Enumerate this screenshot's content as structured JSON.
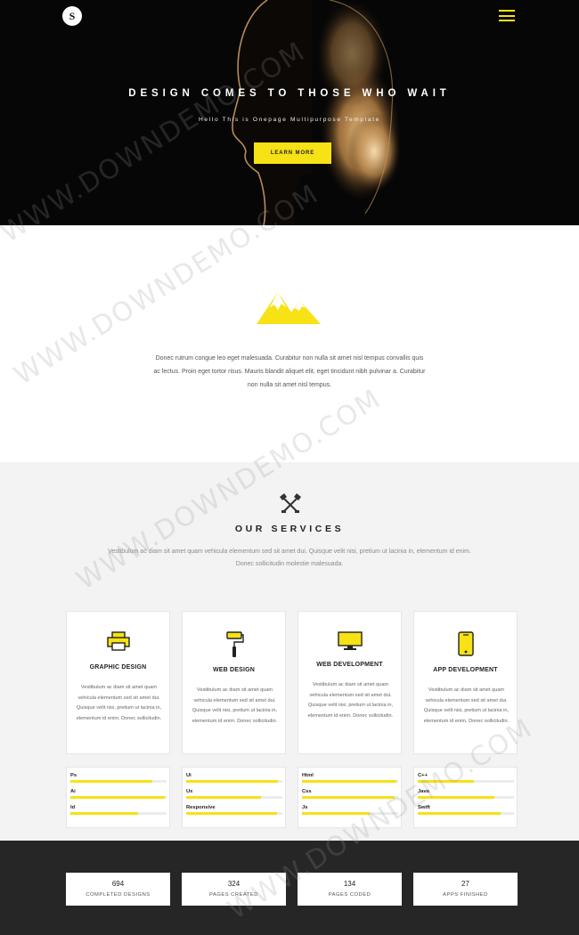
{
  "hero": {
    "logo_text": "S",
    "title": "DESIGN COMES TO THOSE WHO WAIT",
    "subtitle": "Hello This is Onepage Multipurpose Template",
    "button": "LEARN MORE"
  },
  "intro": {
    "text": "Donec rutrum congue leo eget malesuada. Curabitur non nulla sit amet nisl tempus convallis quis ac lectus. Proin eget tortor risus. Mauris blandit aliquet elit, eget tincidunt nibh pulvinar a. Curabitur non nulla sit amet nisl tempus."
  },
  "services": {
    "title": "OUR SERVICES",
    "description": "Vestibulum ac diam sit amet quam vehicula elementum sed sit amet dui. Quisque velit nisi, pretium ut lacinia in, elementum id enim. Donec sollicitudin molestie malesuada.",
    "cards": [
      {
        "title": "GRAPHIC DESIGN",
        "icon": "printer-icon",
        "text": "Vestibulum ac diam sit amet quam vehicula elementum sed sit amet dui. Quisque velit nisi, pretium ut lacinia in, elementum id enim. Donec sollicitudin."
      },
      {
        "title": "WEB DESIGN",
        "icon": "paint-roller-icon",
        "text": "Vestibulum ac diam sit amet quam vehicula elementum sed sit amet dui. Quisque velit nisi, pretium ut lacinia in, elementum id enim. Donec sollicitudin."
      },
      {
        "title": "WEB DEVELOPMENT",
        "icon": "monitor-icon",
        "text": "Vestibulum ac diam sit amet quam vehicula elementum sed sit amet dui. Quisque velit nisi, pretium ut lacinia in, elementum id enim. Donec sollicitudin."
      },
      {
        "title": "APP DEVELOPMENT",
        "icon": "smartphone-icon",
        "text": "Vestibulum ac diam sit amet quam vehicula elementum sed sit amet dui. Quisque velit nisi, pretium ut lacinia in, elementum id enim. Donec sollicitudin."
      }
    ],
    "skills": [
      [
        {
          "label": "Ps",
          "value": 0.85
        },
        {
          "label": "Ai",
          "value": 0.98
        },
        {
          "label": "Id",
          "value": 0.7
        }
      ],
      [
        {
          "label": "Ui",
          "value": 0.95
        },
        {
          "label": "Ux",
          "value": 0.78
        },
        {
          "label": "Responsive",
          "value": 0.94
        }
      ],
      [
        {
          "label": "Html",
          "value": 0.98
        },
        {
          "label": "Css",
          "value": 0.96
        },
        {
          "label": "Js",
          "value": 0.7
        }
      ],
      [
        {
          "label": "C++",
          "value": 0.58
        },
        {
          "label": "Java",
          "value": 0.8
        },
        {
          "label": "Swift",
          "value": 0.86
        }
      ]
    ]
  },
  "stats": [
    {
      "number": "694",
      "label": "COMPLETED DESIGNS"
    },
    {
      "number": "324",
      "label": "PAGES CREATED"
    },
    {
      "number": "134",
      "label": "PAGES CODED"
    },
    {
      "number": "27",
      "label": "APPS FINISHED"
    }
  ],
  "watermark": "WWW.DOWNDEMO.COM",
  "colors": {
    "accent": "#f6e215",
    "dark": "#262626",
    "light_bg": "#f3f3f3"
  }
}
